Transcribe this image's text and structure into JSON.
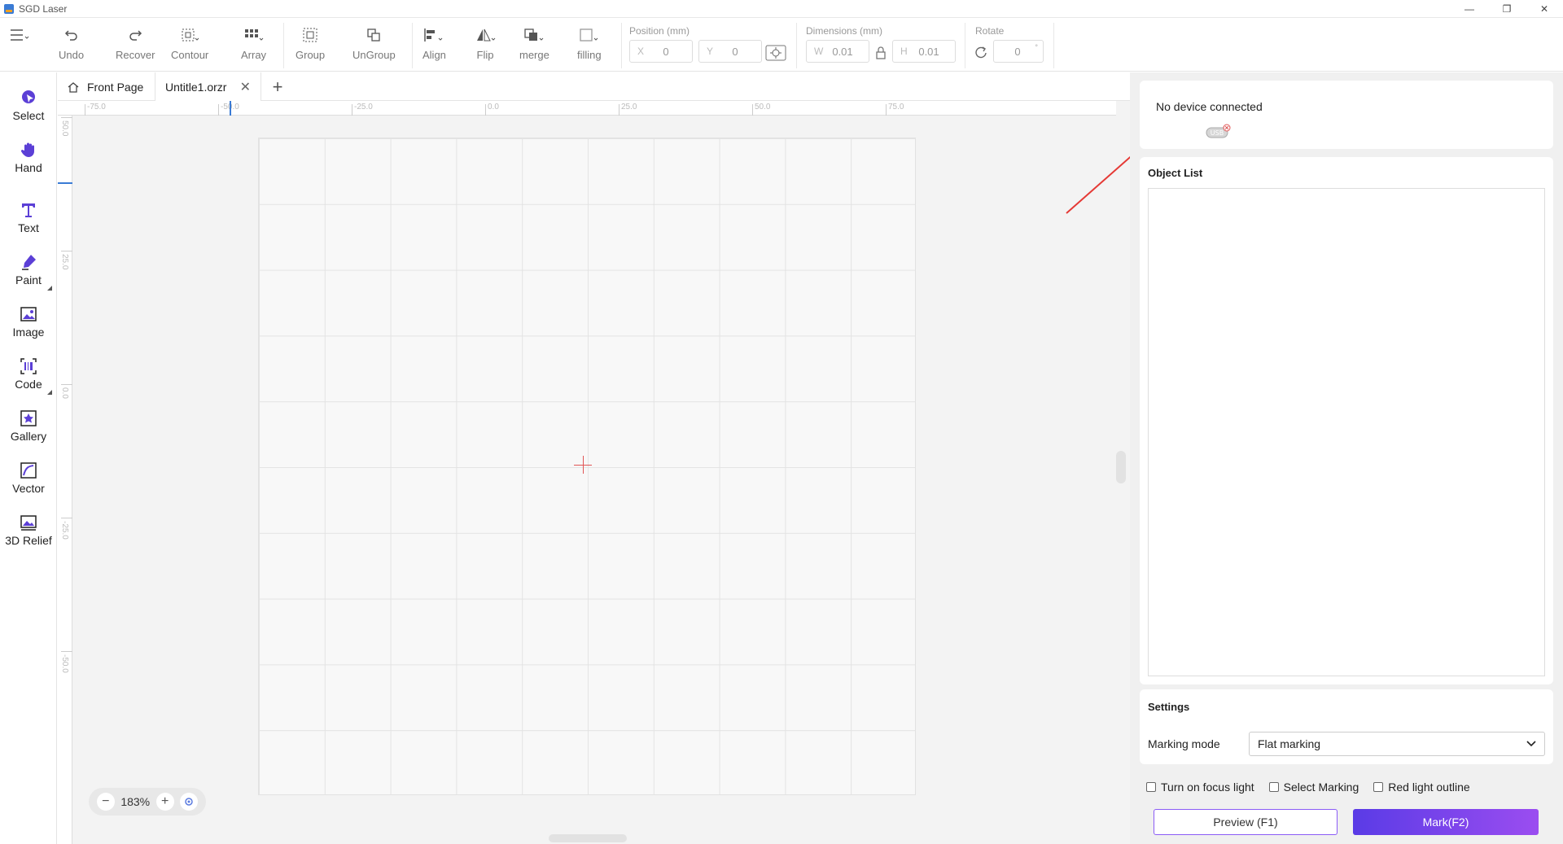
{
  "window": {
    "title": "SGD Laser"
  },
  "toolbar": {
    "undo": "Undo",
    "recover": "Recover",
    "contour": "Contour",
    "array": "Array",
    "group": "Group",
    "ungroup": "UnGroup",
    "align": "Align",
    "flip": "Flip",
    "merge": "merge",
    "filling": "filling",
    "position_label": "Position (mm)",
    "x_prefix": "X",
    "x_value": "0",
    "y_prefix": "Y",
    "y_value": "0",
    "dimensions_label": "Dimensions (mm)",
    "w_prefix": "W",
    "w_value": "0.01",
    "h_prefix": "H",
    "h_value": "0.01",
    "rotate_label": "Rotate",
    "rotate_value": "0",
    "rotate_unit": "°"
  },
  "tools": [
    {
      "label": "Select"
    },
    {
      "label": "Hand"
    },
    {
      "label": "Text"
    },
    {
      "label": "Paint"
    },
    {
      "label": "Image"
    },
    {
      "label": "Code"
    },
    {
      "label": "Gallery"
    },
    {
      "label": "Vector"
    },
    {
      "label": "3D Relief"
    }
  ],
  "tabs": {
    "home": "Front Page",
    "file": "Untitle1.orzr"
  },
  "rulers": {
    "top": [
      "-75.0",
      "-50.0",
      "-25.0",
      "0.0",
      "25.0",
      "50.0",
      "75.0"
    ],
    "left": [
      "50.0",
      "25.0",
      "0.0",
      "-25.0",
      "-50.0"
    ]
  },
  "zoom": {
    "value": "183%"
  },
  "device": {
    "status": "No device connected",
    "usb_label": "USB"
  },
  "object_list": {
    "title": "Object List"
  },
  "settings": {
    "title": "Settings",
    "marking_mode_label": "Marking mode",
    "marking_mode_value": "Flat marking"
  },
  "options": {
    "focus_light": "Turn on focus light",
    "select_marking": "Select Marking",
    "red_light": "Red light outline"
  },
  "actions": {
    "preview": "Preview (F1)",
    "mark": "Mark(F2)"
  },
  "colors": {
    "accent": "#7c4dff",
    "crosshair": "#e05555",
    "annotation_arrow": "#e53935"
  }
}
